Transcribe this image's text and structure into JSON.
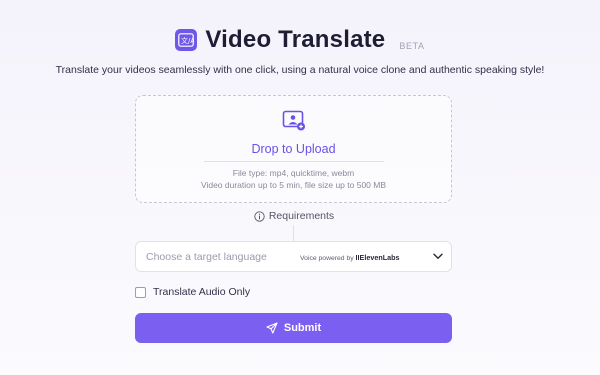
{
  "header": {
    "logo_icon": "translate-icon",
    "title": "Video Translate",
    "badge": "BETA",
    "subtitle": "Translate your videos seamlessly with one click, using a natural voice clone and authentic speaking style!"
  },
  "upload": {
    "icon": "upload-video-icon",
    "label": "Drop to Upload",
    "file_types": "File type: mp4, quicktime, webm",
    "limits": "Video duration up to 5 min, file size up to 500 MB"
  },
  "requirements": {
    "icon": "info-icon",
    "label": "Requirements"
  },
  "language": {
    "placeholder": "Choose a target language",
    "powered_by": "Voice powered by",
    "brand": "IIElevenLabs",
    "icon": "chevron-down-icon"
  },
  "audio_only": {
    "label": "Translate Audio Only",
    "checked": false
  },
  "submit": {
    "icon": "send-icon",
    "label": "Submit"
  },
  "colors": {
    "accent": "#7a5ff0",
    "link": "#6a52e6",
    "title": "#1f1d33"
  }
}
